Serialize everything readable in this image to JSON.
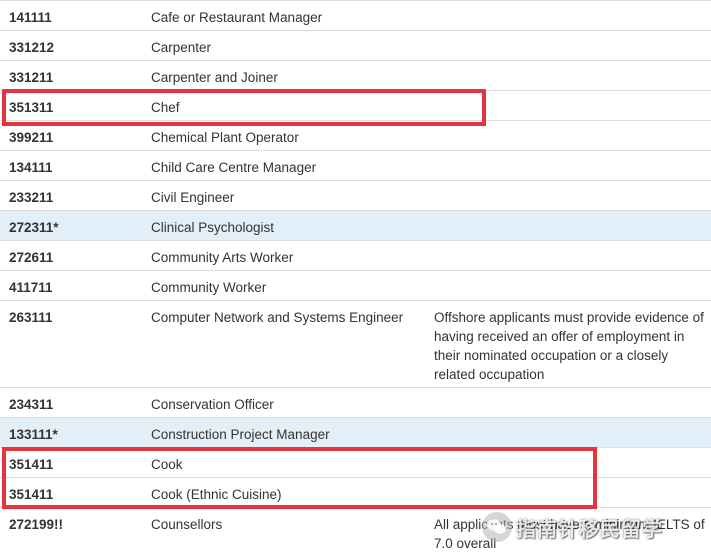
{
  "rows": [
    {
      "code": "141111",
      "occupation": "Cafe or Restaurant Manager",
      "note": ""
    },
    {
      "code": "331212",
      "occupation": "Carpenter",
      "note": ""
    },
    {
      "code": "331211",
      "occupation": "Carpenter and Joiner",
      "note": ""
    },
    {
      "code": "351311",
      "occupation": "Chef",
      "note": ""
    },
    {
      "code": "399211",
      "occupation": "Chemical Plant Operator",
      "note": ""
    },
    {
      "code": "134111",
      "occupation": "Child Care Centre Manager",
      "note": ""
    },
    {
      "code": "233211",
      "occupation": "Civil Engineer",
      "note": ""
    },
    {
      "code": "272311*",
      "occupation": "Clinical Psychologist",
      "note": ""
    },
    {
      "code": "272611",
      "occupation": "Community Arts Worker",
      "note": ""
    },
    {
      "code": "411711",
      "occupation": "Community Worker",
      "note": ""
    },
    {
      "code": "263111",
      "occupation": "Computer Network and Systems Engineer",
      "note": "Offshore applicants must provide evidence of having received an offer of employment in their nominated occupation or a closely related occupation"
    },
    {
      "code": "234311",
      "occupation": "Conservation Officer",
      "note": ""
    },
    {
      "code": "133111*",
      "occupation": "Construction Project Manager",
      "note": ""
    },
    {
      "code": "351411",
      "occupation": "Cook",
      "note": ""
    },
    {
      "code": "351411",
      "occupation": "Cook (Ethnic Cuisine)",
      "note": ""
    },
    {
      "code": "272199!!",
      "occupation": "Counsellors",
      "note": "All applicants must have a minimum IELTS of 7.0 overall"
    }
  ],
  "watermark": {
    "text": "指南针移民留学"
  },
  "colors": {
    "highlight_row": "#e2eef8",
    "red_box": "#e8353d",
    "border": "#dddddd"
  }
}
